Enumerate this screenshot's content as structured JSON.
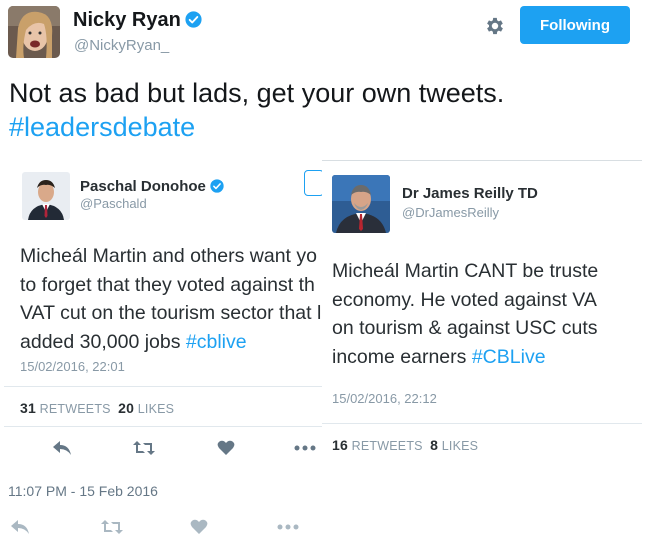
{
  "tweet": {
    "author_name": "Nicky Ryan",
    "author_handle": "@NickyRyan_",
    "follow_label": "Following",
    "text_main": "Not as bad but lads, get your own tweets.",
    "hashtag": "#leadersdebate",
    "timestamp": "11:07 PM - 15 Feb 2016"
  },
  "embedded_left": {
    "name": "Paschal Donohoe",
    "handle": "@Paschald",
    "lines": [
      "Micheál Martin and others want yo",
      "to forget that they voted against th",
      "VAT cut on the tourism sector that l",
      "added 30,000 jobs"
    ],
    "link": "#cblive",
    "date": "15/02/2016, 22:01",
    "retweets": "31",
    "retweets_label": "RETWEETS",
    "likes": "20",
    "likes_label": "LIKES"
  },
  "embedded_right": {
    "name": "Dr James Reilly TD",
    "handle": "@DrJamesReilly",
    "lines": [
      "Micheál Martin CANT be truste",
      "economy. He voted against VA",
      "on tourism & against USC cuts",
      "income earners"
    ],
    "link": "#CBLive",
    "date": "15/02/2016, 22:12",
    "retweets": "16",
    "retweets_label": "RETWEETS",
    "likes": "8",
    "likes_label": "LIKES"
  },
  "colors": {
    "accent": "#1da1f2",
    "muted": "#8899a6",
    "text": "#14171a"
  },
  "icons": [
    "verified-icon",
    "gear-icon",
    "reply-icon",
    "retweet-icon",
    "like-icon",
    "more-icon"
  ]
}
